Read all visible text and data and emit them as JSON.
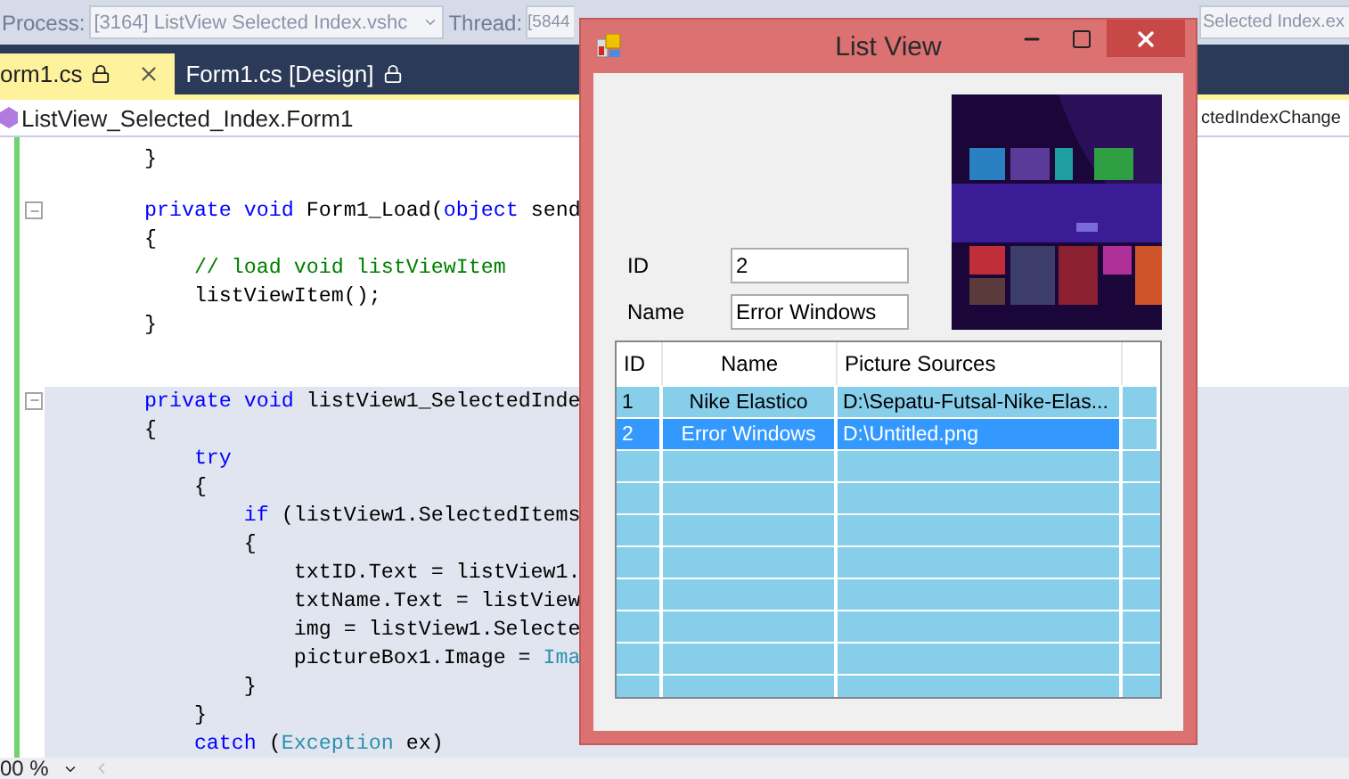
{
  "debug_bar": {
    "process_label": "Process:",
    "process": "[3164] ListView Selected Index.vshc",
    "thread_label": "Thread:",
    "thread": "[5844",
    "frame": "Selected Index.ex"
  },
  "tabs": [
    {
      "label": "orm1.cs",
      "selected": true
    },
    {
      "label": "Form1.cs [Design]",
      "selected": false
    }
  ],
  "nav_bar": {
    "type": "ListView_Selected_Index.Form1",
    "member": "ctedIndexChange"
  },
  "code_lines": [
    {
      "kind": "line",
      "highlighted": false,
      "tokens": [
        {
          "kind": "plain",
          "text": "        }"
        }
      ]
    },
    {
      "kind": "blank",
      "highlighted": false
    },
    {
      "kind": "fold",
      "highlighted": false,
      "tokens": [
        {
          "kind": "keyword",
          "text": "        private void"
        },
        {
          "kind": "plain",
          "text": " Form1_Load("
        },
        {
          "kind": "keyword",
          "text": "object"
        },
        {
          "kind": "plain",
          "text": " send"
        }
      ]
    },
    {
      "kind": "line",
      "highlighted": false,
      "tokens": [
        {
          "kind": "plain",
          "text": "        {"
        }
      ]
    },
    {
      "kind": "line",
      "highlighted": false,
      "tokens": [
        {
          "kind": "comment",
          "text": "            // load void listViewItem"
        }
      ]
    },
    {
      "kind": "line",
      "highlighted": false,
      "tokens": [
        {
          "kind": "plain",
          "text": "            listViewItem();"
        }
      ]
    },
    {
      "kind": "line",
      "highlighted": false,
      "tokens": [
        {
          "kind": "plain",
          "text": "        }"
        }
      ]
    },
    {
      "kind": "blank",
      "highlighted": false
    },
    {
      "kind": "blank",
      "highlighted": false
    },
    {
      "kind": "fold",
      "highlighted": true,
      "tokens": [
        {
          "kind": "keyword",
          "text": "        private void"
        },
        {
          "kind": "plain",
          "text": " listView1_SelectedInde"
        }
      ]
    },
    {
      "kind": "line",
      "highlighted": true,
      "tokens": [
        {
          "kind": "plain",
          "text": "        {"
        }
      ]
    },
    {
      "kind": "line",
      "highlighted": true,
      "tokens": [
        {
          "kind": "keyword",
          "text": "            try"
        }
      ]
    },
    {
      "kind": "line",
      "highlighted": true,
      "tokens": [
        {
          "kind": "plain",
          "text": "            {"
        }
      ]
    },
    {
      "kind": "line",
      "highlighted": true,
      "tokens": [
        {
          "kind": "keyword",
          "text": "                if"
        },
        {
          "kind": "plain",
          "text": " (listView1.SelectedItems"
        }
      ]
    },
    {
      "kind": "line",
      "highlighted": true,
      "tokens": [
        {
          "kind": "plain",
          "text": "                {"
        }
      ]
    },
    {
      "kind": "line",
      "highlighted": true,
      "tokens": [
        {
          "kind": "plain",
          "text": "                    txtID.Text = listView1."
        }
      ]
    },
    {
      "kind": "line",
      "highlighted": true,
      "tokens": [
        {
          "kind": "plain",
          "text": "                    txtName.Text = listView"
        }
      ]
    },
    {
      "kind": "line",
      "highlighted": true,
      "tokens": [
        {
          "kind": "plain",
          "text": "                    img = listView1.Selecte"
        }
      ]
    },
    {
      "kind": "line",
      "highlighted": true,
      "tokens": [
        {
          "kind": "plain",
          "text": "                    pictureBox1.Image = "
        },
        {
          "kind": "type",
          "text": "Ima"
        }
      ]
    },
    {
      "kind": "line",
      "highlighted": true,
      "tokens": [
        {
          "kind": "plain",
          "text": "                }"
        }
      ]
    },
    {
      "kind": "line",
      "highlighted": true,
      "tokens": [
        {
          "kind": "plain",
          "text": "            }"
        }
      ]
    },
    {
      "kind": "line",
      "highlighted": true,
      "tokens": [
        {
          "kind": "keyword",
          "text": "            catch"
        },
        {
          "kind": "plain",
          "text": " ("
        },
        {
          "kind": "type",
          "text": "Exception"
        },
        {
          "kind": "plain",
          "text": " ex)"
        }
      ]
    }
  ],
  "status_bar": {
    "zoom": "00 %"
  },
  "window": {
    "title": "List View",
    "fields": [
      {
        "label": "ID",
        "value": "2"
      },
      {
        "label": "Name",
        "value": "Error Windows"
      }
    ],
    "list": {
      "columns": [
        "ID",
        "Name",
        "Picture Sources"
      ],
      "rows": [
        {
          "cells": [
            "1",
            "Nike Elastico",
            "D:\\Sepatu-Futsal-Nike-Elas..."
          ],
          "selected": false
        },
        {
          "cells": [
            "2",
            "Error Windows",
            "D:\\Untitled.png"
          ],
          "selected": true
        }
      ]
    }
  }
}
